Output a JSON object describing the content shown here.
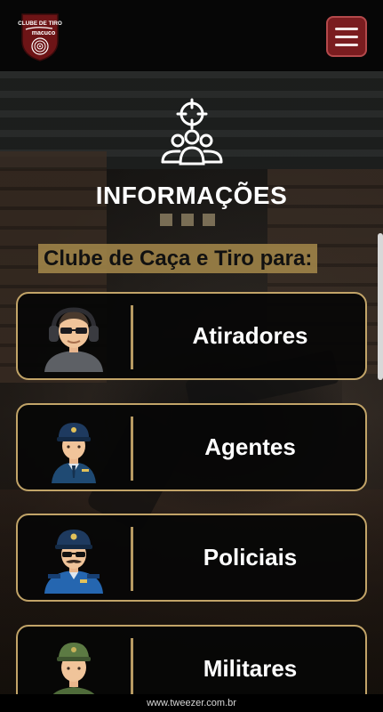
{
  "header": {
    "logo": {
      "icon": "club-logo-target",
      "text_line1": "CLUBE DE TIRO",
      "text_line2": "macuco"
    },
    "menu_icon": "hamburger-icon"
  },
  "section": {
    "icon": "crosshair-users-icon",
    "title": "INFORMAÇÕES",
    "subtitle": "Clube de Caça e Tiro para:"
  },
  "cards": [
    {
      "label": "Atiradores",
      "icon": "shooter-headset-avatar"
    },
    {
      "label": "Agentes",
      "icon": "agent-avatar"
    },
    {
      "label": "Policiais",
      "icon": "police-officer-avatar"
    },
    {
      "label": "Militares",
      "icon": "soldier-avatar"
    }
  ],
  "footer": {
    "text": "www.tweezer.com.br"
  },
  "colors": {
    "brand": "#7a1c1f",
    "accent_gold": "#c2a468",
    "subtitle_bg": "#9e8348",
    "card_bg": "#060606"
  }
}
